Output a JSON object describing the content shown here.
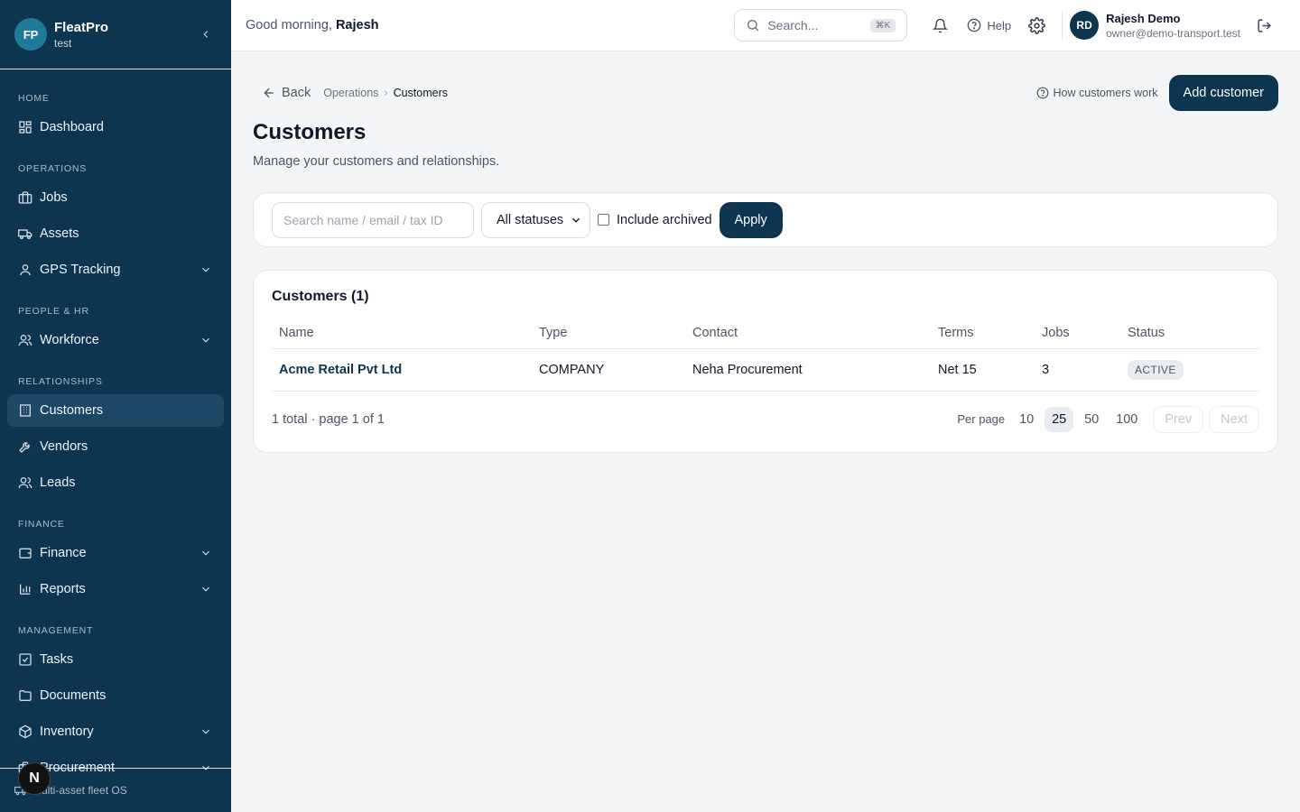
{
  "brand": {
    "initials": "FP",
    "name": "FleatPro",
    "sub": "test"
  },
  "nav": {
    "sections": [
      {
        "title": "HOME",
        "items": [
          {
            "label": "Dashboard",
            "icon": "dashboard-icon"
          }
        ]
      },
      {
        "title": "OPERATIONS",
        "items": [
          {
            "label": "Jobs",
            "icon": "briefcase-icon"
          },
          {
            "label": "Assets",
            "icon": "truck-icon"
          },
          {
            "label": "GPS Tracking",
            "icon": "map-pin-icon",
            "expandable": true
          }
        ]
      },
      {
        "title": "PEOPLE & HR",
        "items": [
          {
            "label": "Workforce",
            "icon": "users-icon",
            "expandable": true
          }
        ]
      },
      {
        "title": "RELATIONSHIPS",
        "items": [
          {
            "label": "Customers",
            "icon": "building-icon",
            "active": true
          },
          {
            "label": "Vendors",
            "icon": "wrench-icon"
          },
          {
            "label": "Leads",
            "icon": "users-icon"
          }
        ]
      },
      {
        "title": "FINANCE",
        "items": [
          {
            "label": "Finance",
            "icon": "wallet-icon",
            "expandable": true
          },
          {
            "label": "Reports",
            "icon": "bar-chart-icon",
            "expandable": true
          }
        ]
      },
      {
        "title": "MANAGEMENT",
        "items": [
          {
            "label": "Tasks",
            "icon": "check-square-icon"
          },
          {
            "label": "Documents",
            "icon": "folder-icon"
          },
          {
            "label": "Inventory",
            "icon": "package-icon",
            "expandable": true
          },
          {
            "label": "Procurement",
            "icon": "briefcase-icon",
            "expandable": true
          }
        ]
      }
    ],
    "footer": "Multi-asset fleet OS",
    "badge": "N"
  },
  "topbar": {
    "greeting_prefix": "Good morning,",
    "greeting_name": "Rajesh",
    "search_placeholder": "Search...",
    "search_shortcut": "⌘K",
    "help_label": "Help",
    "user": {
      "initials": "RD",
      "name": "Rajesh Demo",
      "email": "owner@demo-transport.test"
    }
  },
  "page": {
    "back_label": "Back",
    "breadcrumb": [
      "Operations",
      "Customers"
    ],
    "how_label": "How customers work",
    "add_label": "Add customer",
    "title": "Customers",
    "subtitle": "Manage your customers and relationships."
  },
  "filters": {
    "search_placeholder": "Search name / email / tax ID",
    "status_value": "All statuses",
    "include_archived": "Include archived",
    "apply": "Apply"
  },
  "table": {
    "title": "Customers (1)",
    "columns": [
      "Name",
      "Type",
      "Contact",
      "Terms",
      "Jobs",
      "Status"
    ],
    "rows": [
      {
        "name": "Acme Retail Pvt Ltd",
        "type": "COMPANY",
        "contact": "Neha Procurement",
        "terms": "Net 15",
        "jobs": "3",
        "status": "ACTIVE"
      }
    ]
  },
  "pager": {
    "summary": "1 total · page 1 of 1",
    "per_page_label": "Per page",
    "options": [
      "10",
      "25",
      "50",
      "100"
    ],
    "selected": "25",
    "prev": "Prev",
    "next": "Next"
  },
  "colors": {
    "sidebar": "#0d3550",
    "active_nav": "#1c4866",
    "primary": "#0d3550"
  }
}
